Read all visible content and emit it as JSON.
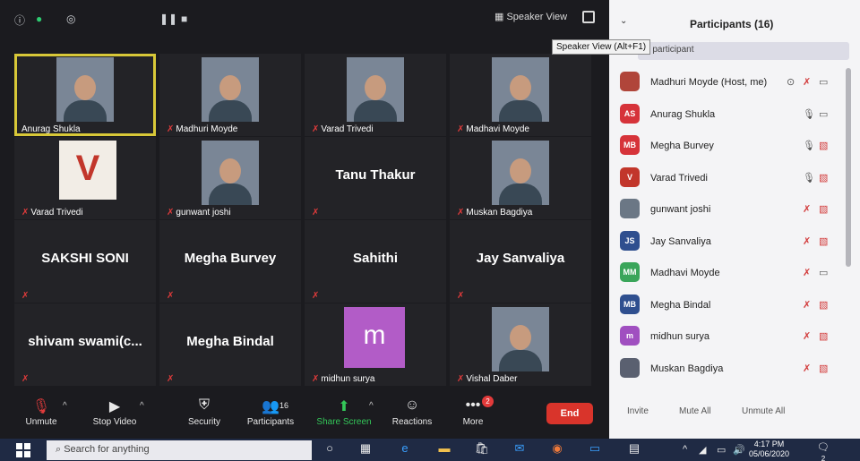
{
  "meeting": {
    "speaker_view_label": "Speaker View",
    "tooltip": "Speaker View (Alt+F1)"
  },
  "tiles": [
    {
      "name": "Anurag Shukla",
      "type": "video",
      "active": true
    },
    {
      "name": "Madhuri Moyde",
      "type": "video"
    },
    {
      "name": "Varad Trivedi",
      "type": "video"
    },
    {
      "name": "Madhavi Moyde",
      "type": "video"
    },
    {
      "name": "Varad Trivedi",
      "type": "logo"
    },
    {
      "name": "gunwant joshi",
      "type": "video"
    },
    {
      "name": "Tanu Thakur",
      "type": "bigname"
    },
    {
      "name": "Muskan Bagdiya",
      "type": "video"
    },
    {
      "name": "SAKSHI SONI",
      "type": "bigname"
    },
    {
      "name": "Megha Burvey",
      "type": "bigname"
    },
    {
      "name": "Sahithi",
      "type": "bigname"
    },
    {
      "name": "Jay Sanvaliya",
      "type": "bigname"
    },
    {
      "name": "shivam  swami(c...",
      "type": "bigname"
    },
    {
      "name": "Megha Bindal",
      "type": "bigname"
    },
    {
      "name": "midhun surya",
      "type": "avatar",
      "avatar_letter": "m"
    },
    {
      "name": "Vishal Daber",
      "type": "video"
    }
  ],
  "controls": {
    "unmute": "Unmute",
    "stop_video": "Stop Video",
    "security": "Security",
    "participants": "Participants",
    "participants_count": "16",
    "share_screen": "Share Screen",
    "reactions": "Reactions",
    "more": "More",
    "more_badge": "2",
    "end": "End"
  },
  "panel": {
    "title": "Participants (16)",
    "search_placeholder": "a participant",
    "participants": [
      {
        "name": "Madhuri Moyde (Host, me)",
        "avatar": "photo",
        "color": "#b0453a",
        "mic": "off",
        "video": "on"
      },
      {
        "name": "Anurag Shukla",
        "avatar": "AS",
        "color": "#d6333a",
        "mic": "on",
        "video": "on"
      },
      {
        "name": "Megha Burvey",
        "avatar": "MB",
        "color": "#d6333a",
        "mic": "on",
        "video": "off"
      },
      {
        "name": "Varad Trivedi",
        "avatar": "V",
        "color": "#c2362b",
        "mic": "on",
        "video": "off"
      },
      {
        "name": "gunwant joshi",
        "avatar": "photo",
        "color": "#6b7785",
        "mic": "off",
        "video": "off"
      },
      {
        "name": "Jay Sanvaliya",
        "avatar": "JS",
        "color": "#2f4f8f",
        "mic": "off",
        "video": "off"
      },
      {
        "name": "Madhavi Moyde",
        "avatar": "MM",
        "color": "#3aa55a",
        "mic": "off",
        "video": "on"
      },
      {
        "name": "Megha Bindal",
        "avatar": "MB",
        "color": "#2f4f8f",
        "mic": "off",
        "video": "off"
      },
      {
        "name": "midhun surya",
        "avatar": "m",
        "color": "#a04fc0",
        "mic": "off",
        "video": "off"
      },
      {
        "name": "Muskan Bagdiya",
        "avatar": "photo",
        "color": "#5a6070",
        "mic": "off",
        "video": "off"
      }
    ],
    "footer": {
      "invite": "Invite",
      "mute_all": "Mute All",
      "unmute_all": "Unmute All"
    }
  },
  "taskbar": {
    "search_placeholder": "Search for anything",
    "time": "4:17 PM",
    "date": "05/06/2020",
    "notifications": "2"
  }
}
